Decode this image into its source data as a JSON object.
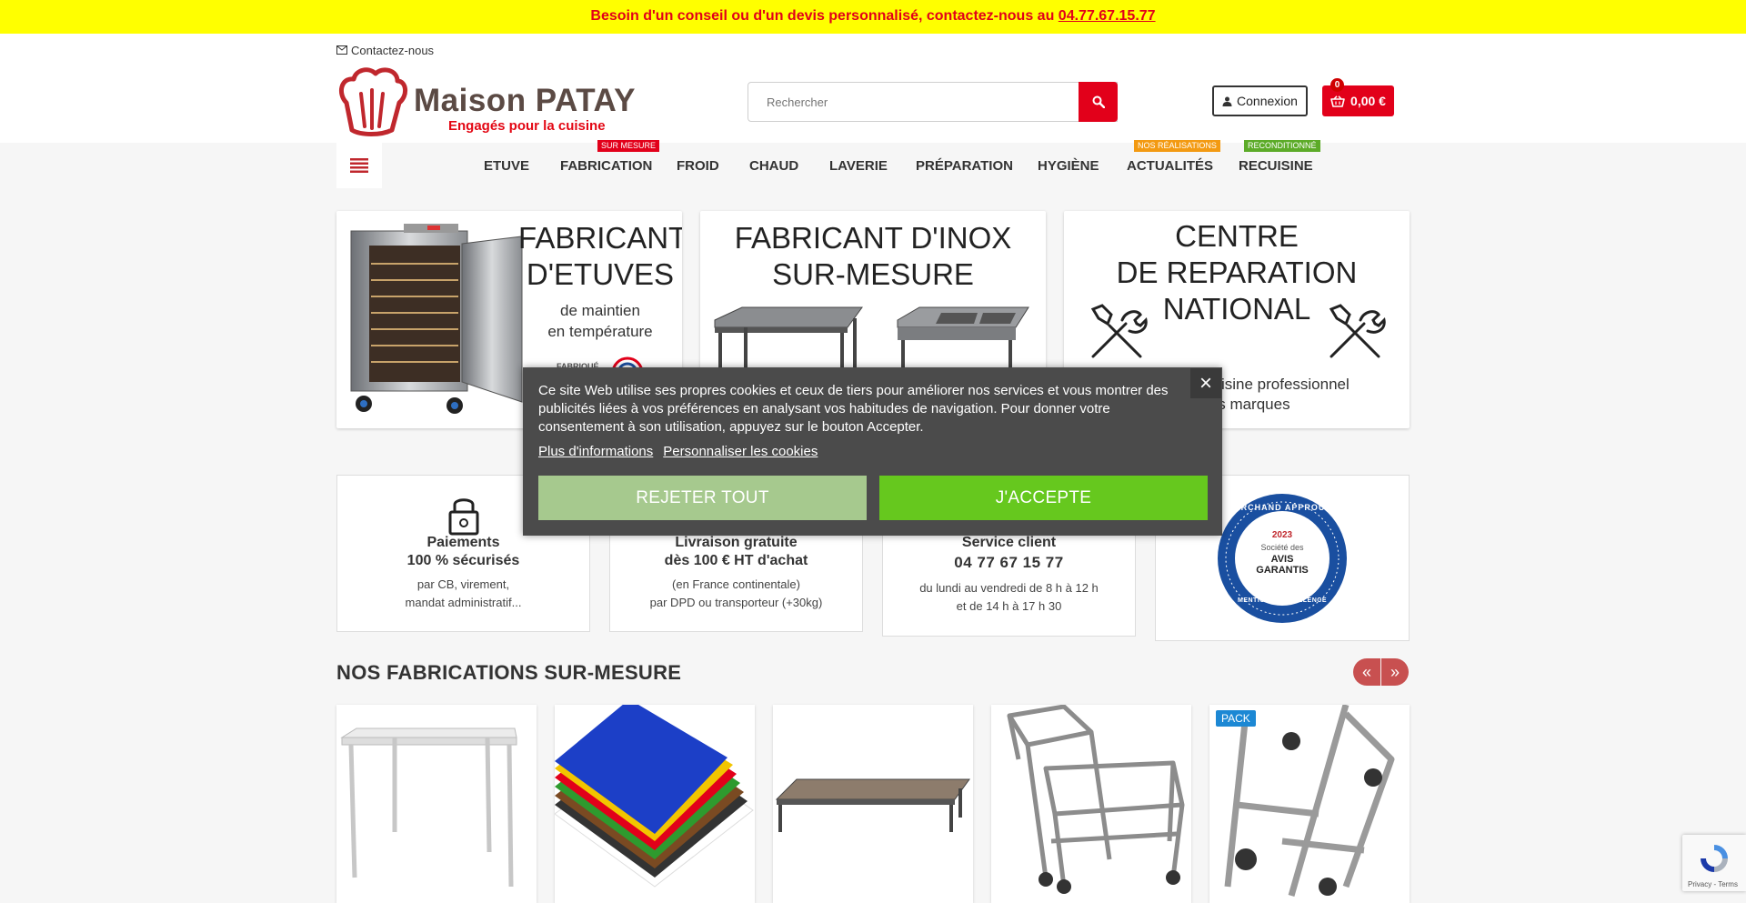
{
  "announcement": {
    "text": "Besoin d'un conseil ou d'un devis personnalisé, contactez-nous au",
    "phone": "04.77.67.15.77"
  },
  "header": {
    "contact_label": "Contactez-nous",
    "logo_name": "Maison PATAY",
    "logo_tagline": "Engagés pour la cuisine",
    "search_placeholder": "Rechercher",
    "login_label": "Connexion",
    "cart_count": "0",
    "cart_total": "0,00 €"
  },
  "nav": {
    "items": [
      "ETUVE",
      "FABRICATION",
      "FROID",
      "CHAUD",
      "LAVERIE",
      "PRÉPARATION",
      "HYGIÈNE",
      "ACTUALITÉS",
      "RECUISINE"
    ],
    "badges": {
      "fabrication": "SUR MESURE",
      "actualites": "NOS RÉALISATIONS",
      "recuisine": "RECONDITIONNÉ"
    },
    "badge_colors": {
      "fabrication": "#e2001a",
      "actualites": "#f39a12",
      "recuisine": "#5cab28"
    }
  },
  "banners": [
    {
      "title_1": "FABRICANT",
      "title_2": "D'ETUVES",
      "sub_1": "de maintien",
      "sub_2": "en température",
      "stamp": "FABRIQUÉ EN FRANCE"
    },
    {
      "title_1": "FABRICANT D'INOX",
      "title_2": "SUR-MESURE"
    },
    {
      "title_1": "CENTRE",
      "title_2": "DE REPARATION",
      "title_3": "NATIONAL",
      "sub_1": "Matériel de cuisine professionnel",
      "sub_2": "toutes marques"
    }
  ],
  "features": [
    {
      "title_1": "Paiements",
      "title_2": "100 % sécurisés",
      "line_1": "par CB, virement,",
      "line_2": "mandat administratif..."
    },
    {
      "title_1": "Livraison gratuite",
      "title_2": "dès 100 € HT d'achat",
      "line_1": "(en France continentale)",
      "line_2": "par DPD ou transporteur (+30kg)"
    },
    {
      "title_1": "Service client",
      "title_2": "04 77 67 15 77",
      "line_1": "du lundi au vendredi de 8 h à 12 h",
      "line_2": "et de 14 h à 17 h 30"
    }
  ],
  "seal": {
    "top": "MARCHAND APPROUVÉ",
    "year": "2023",
    "society": "Société des",
    "main": "AVIS GARANTIS",
    "bottom": "MENTION D'EXCELLENCE"
  },
  "section": {
    "title": "NOS FABRICATIONS SUR-MESURE",
    "prev": "«",
    "next": "»"
  },
  "products": [
    {
      "name": "table"
    },
    {
      "name": "cutting-boards"
    },
    {
      "name": "shelf"
    },
    {
      "name": "trolley"
    },
    {
      "name": "hand-truck",
      "badge": "PACK"
    }
  ],
  "cookie": {
    "text": "Ce site Web utilise ses propres cookies et ceux de tiers pour améliorer nos services et vous montrer des publicités liées à vos préférences en analysant vos habitudes de navigation. Pour donner votre consentement à son utilisation, appuyez sur le bouton Accepter.",
    "more_info": "Plus d'informations",
    "customize": "Personnaliser les cookies",
    "reject": "REJETER TOUT",
    "accept": "J'ACCEPTE",
    "close": "×"
  },
  "recaptcha": {
    "legal": "Privacy - Terms"
  }
}
